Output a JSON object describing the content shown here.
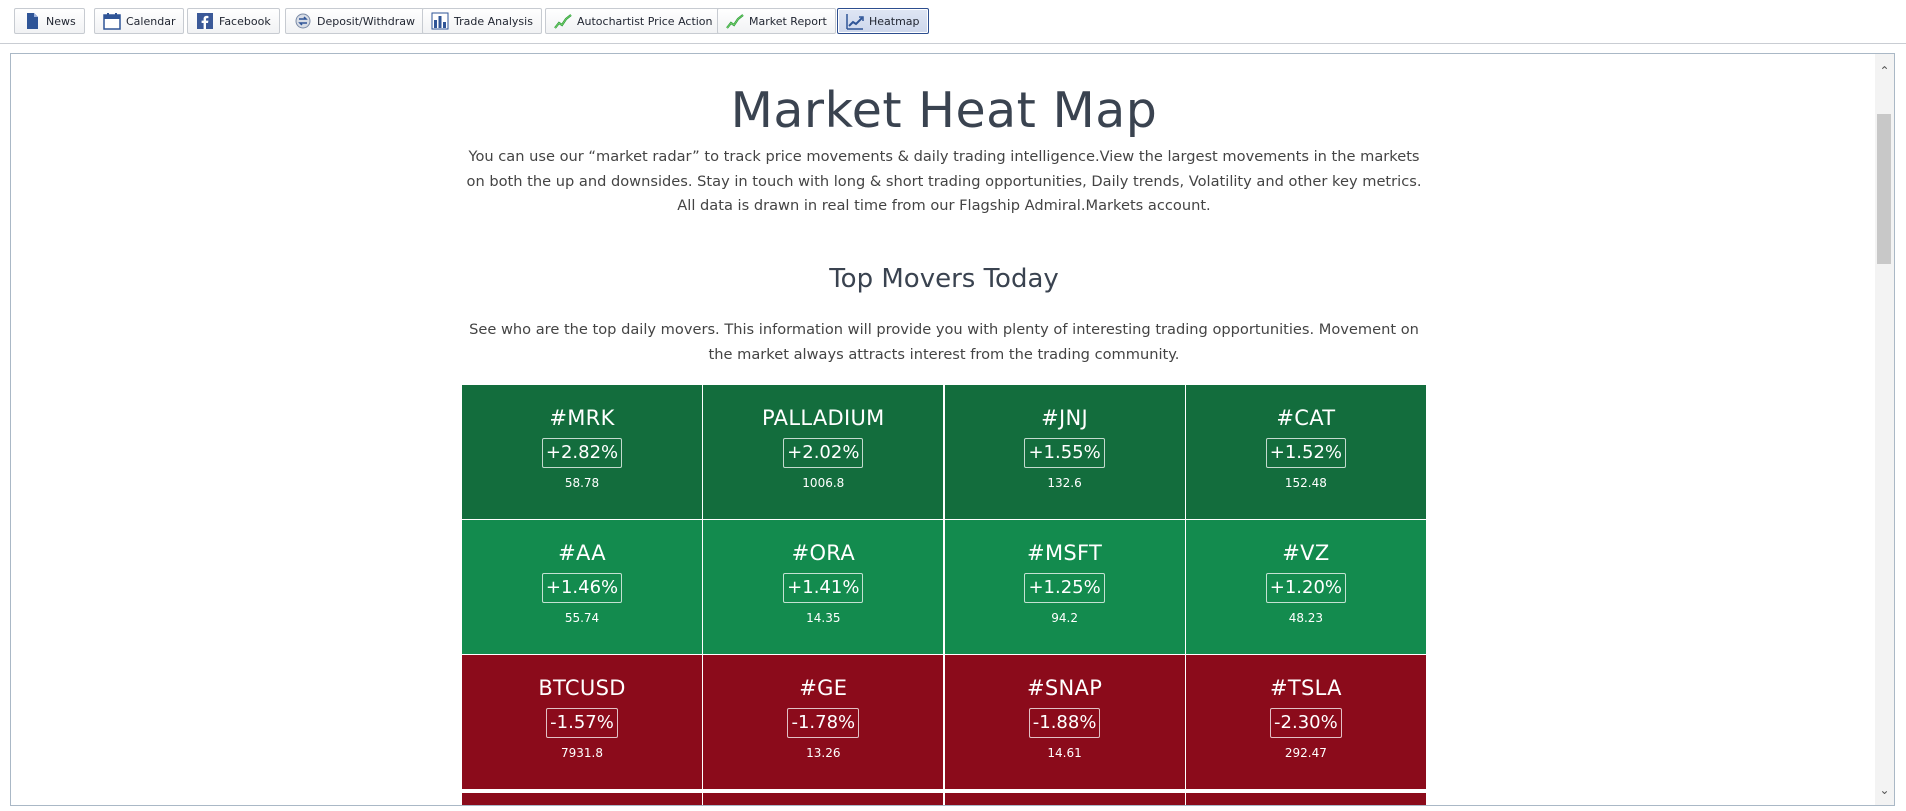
{
  "toolbar": {
    "items": [
      {
        "label": "News",
        "icon": "document-icon"
      },
      {
        "label": "Calendar",
        "icon": "calendar-icon"
      },
      {
        "label": "Facebook",
        "icon": "facebook-icon"
      },
      {
        "label": "Deposit/Withdraw",
        "icon": "exchange-icon"
      },
      {
        "label": "Trade Analysis",
        "icon": "bar-chart-icon"
      },
      {
        "label": "Autochartist Price Action",
        "icon": "trend-icon"
      },
      {
        "label": "Market Report",
        "icon": "trend-icon"
      },
      {
        "label": "Heatmap",
        "icon": "heatmap-icon",
        "active": true
      }
    ]
  },
  "page": {
    "title": "Market Heat Map",
    "intro": "You can use our “market radar” to track price movements & daily trading intelligence.View the largest movements in the markets on both the up and downsides. Stay in touch with long & short trading opportunities, Daily trends, Volatility and other key metrics. All data is drawn in real time from our Flagship Admiral.Markets account.",
    "section_title": "Top Movers Today",
    "section_desc": "See who are the top daily movers. This information will provide you with plenty of interesting trading opportunities. Movement on the market always attracts interest from the trading community."
  },
  "heatmap": {
    "colors": {
      "strong_up": "#136d3d",
      "up": "#138b4e",
      "down": "#8b0b1b"
    },
    "tiles": [
      {
        "symbol": "#MRK",
        "change": "+2.82%",
        "price": "58.78"
      },
      {
        "symbol": "PALLADIUM",
        "change": "+2.02%",
        "price": "1006.8"
      },
      {
        "symbol": "#JNJ",
        "change": "+1.55%",
        "price": "132.6"
      },
      {
        "symbol": "#CAT",
        "change": "+1.52%",
        "price": "152.48"
      },
      {
        "symbol": "#AA",
        "change": "+1.46%",
        "price": "55.74"
      },
      {
        "symbol": "#ORA",
        "change": "+1.41%",
        "price": "14.35"
      },
      {
        "symbol": "#MSFT",
        "change": "+1.25%",
        "price": "94.2"
      },
      {
        "symbol": "#VZ",
        "change": "+1.20%",
        "price": "48.23"
      },
      {
        "symbol": "BTCUSD",
        "change": "-1.57%",
        "price": "7931.8"
      },
      {
        "symbol": "#GE",
        "change": "-1.78%",
        "price": "13.26"
      },
      {
        "symbol": "#SNAP",
        "change": "-1.88%",
        "price": "14.61"
      },
      {
        "symbol": "#TSLA",
        "change": "-2.30%",
        "price": "292.47"
      }
    ]
  }
}
